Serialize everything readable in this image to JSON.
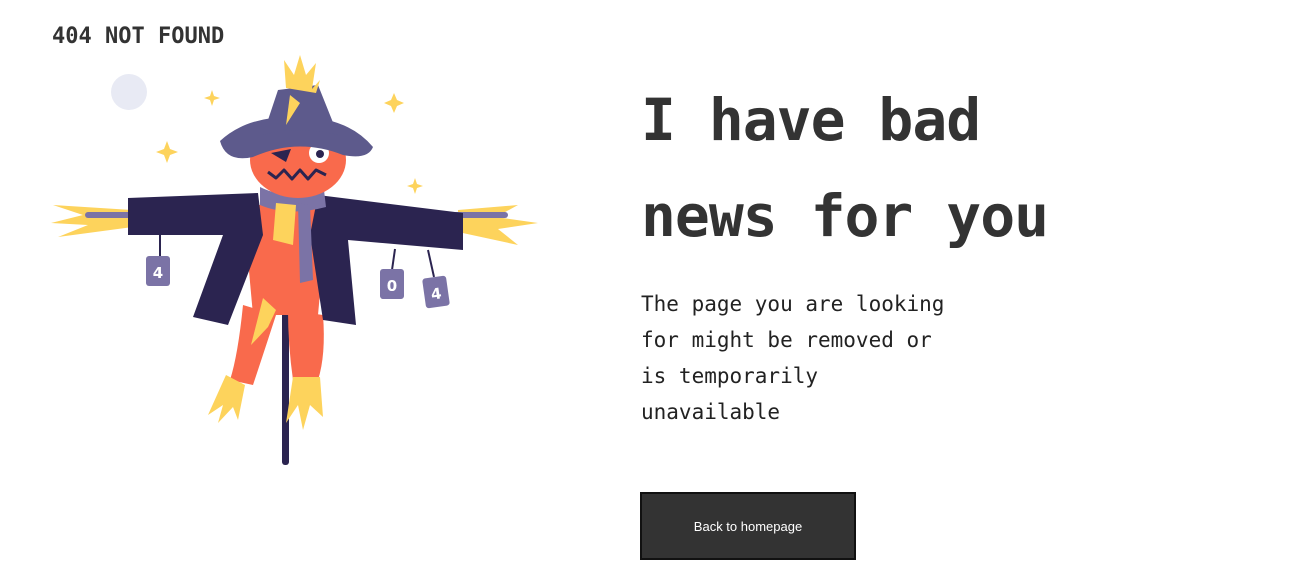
{
  "header": {
    "brand_title": "404 NOT FOUND"
  },
  "main": {
    "headline_lines": [
      "I have bad",
      "news for you"
    ],
    "message_lines": [
      "The page you are looking",
      "for might be removed or",
      "is temporarily",
      "unavailable"
    ],
    "home_button_label": "Back to homepage"
  },
  "illustration": {
    "subject": "scarecrow-illustration",
    "can_labels": [
      "4",
      "0",
      "4"
    ]
  },
  "colors": {
    "text": "#333333",
    "button_bg": "#333333",
    "button_text": "#ffffff",
    "hat": "#5d5a8c",
    "coat": "#2b2450",
    "head": "#f96a4c",
    "straw": "#fdd35c",
    "moon": "#e8eaf4",
    "can": "#7b73a6"
  }
}
